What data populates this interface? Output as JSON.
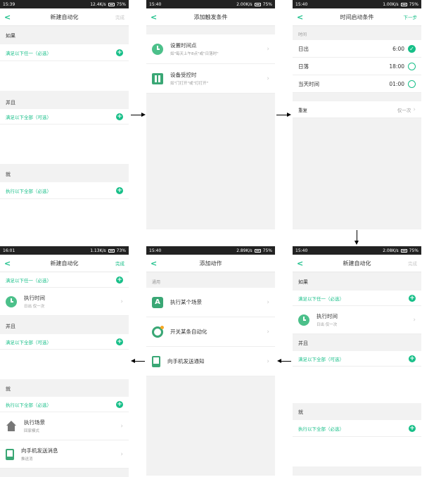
{
  "colors": {
    "accent": "#17bf88",
    "statusbar": "#222222",
    "background": "#f2f2f2"
  },
  "p1": {
    "status": {
      "time": "15:39",
      "speed": "12.4K/s",
      "battery": "75%"
    },
    "title": "新建自动化",
    "right": "完成",
    "sec_if": "如果",
    "if_row": "满足以下任一（必选）",
    "sec_and": "并且",
    "and_row": "满足以下全部（可选）",
    "sec_then": "就",
    "then_row": "执行以下全部（必选）"
  },
  "p2": {
    "status": {
      "time": "15:40",
      "speed": "2.00K/s",
      "battery": "75%"
    },
    "title": "添加触发条件",
    "items": [
      {
        "title": "设置时间点",
        "sub": "如\"每天上午8点\"或\"日落时\""
      },
      {
        "title": "设备受控时",
        "sub": "如\"门打开\"或\"灯打开\""
      }
    ]
  },
  "p3": {
    "status": {
      "time": "15:40",
      "speed": "1.00K/s",
      "battery": "75%"
    },
    "title": "时间启动条件",
    "right": "下一步",
    "sec_time": "时间",
    "rows": [
      {
        "label": "日出",
        "value": "6:00"
      },
      {
        "label": "日落",
        "value": "18:00"
      },
      {
        "label": "当天时间",
        "value": "01:00"
      }
    ],
    "repeat_label": "重复",
    "repeat_value": "仅一次"
  },
  "p4": {
    "status": {
      "time": "16:01",
      "speed": "1.13K/s",
      "battery": "73%"
    },
    "title": "新建自动化",
    "right": "完成",
    "if_row": "满足以下任一（必选）",
    "exec_time": {
      "title": "执行时间",
      "sub": "日出 仅一次"
    },
    "sec_and": "并且",
    "and_row": "满足以下全部（可选）",
    "sec_then": "就",
    "then_row": "执行以下全部（必选）",
    "scene": {
      "title": "执行场景",
      "sub": "回家模式"
    },
    "notify": {
      "title": "向手机发送消息",
      "sub": "推送消"
    }
  },
  "p5": {
    "status": {
      "time": "15:40",
      "speed": "2.89K/s",
      "battery": "75%"
    },
    "title": "添加动作",
    "sec": "通用",
    "items": [
      {
        "title": "执行某个场景"
      },
      {
        "title": "开关某条自动化"
      },
      {
        "title": "向手机发送通知"
      }
    ]
  },
  "p6": {
    "status": {
      "time": "15:40",
      "speed": "2.08K/s",
      "battery": "75%"
    },
    "title": "新建自动化",
    "right": "完成",
    "sec_if": "如果",
    "if_row": "满足以下任一（必选）",
    "exec_time": {
      "title": "执行时间",
      "sub": "日出 仅一次"
    },
    "sec_and": "并且",
    "and_row": "满足以下全部（可选）",
    "sec_then": "就",
    "then_row": "执行以下全部（必选）"
  }
}
